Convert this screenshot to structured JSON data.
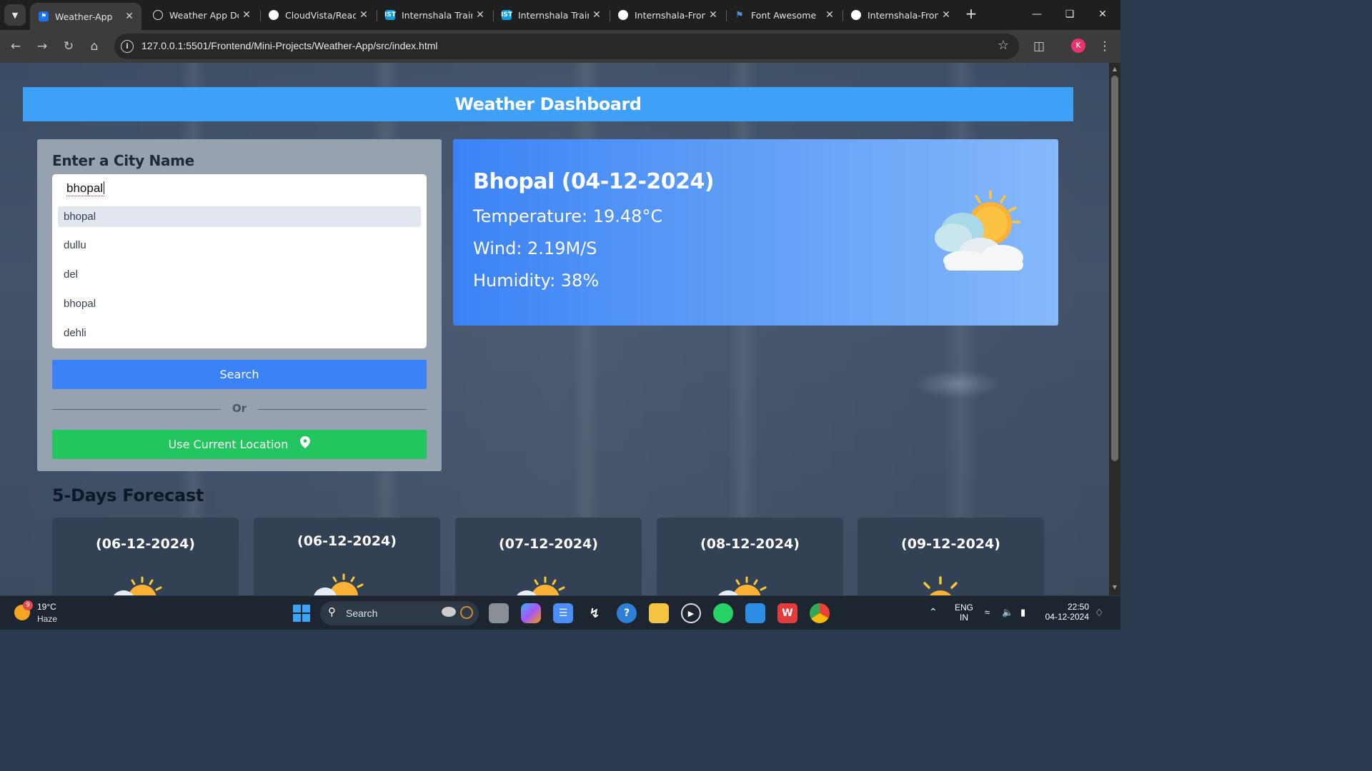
{
  "browser": {
    "tabs": [
      {
        "title": "Weather-App",
        "favicon": "weather-favicon",
        "active": true
      },
      {
        "title": "Weather App Do",
        "favicon": "chatgpt-favicon"
      },
      {
        "title": "CloudVista/Read",
        "favicon": "github-favicon"
      },
      {
        "title": "Internshala Train",
        "favicon": "ist-favicon"
      },
      {
        "title": "Internshala Train",
        "favicon": "ist-favicon"
      },
      {
        "title": "Internshala-Fron",
        "favicon": "github-favicon"
      },
      {
        "title": "Font Awesome",
        "favicon": "fontawesome-favicon"
      },
      {
        "title": "Internshala-Fron",
        "favicon": "github-favicon"
      }
    ],
    "favicon_text": {
      "ist": "IST"
    },
    "url": "127.0.0.1:5501/Frontend/Mini-Projects/Weather-App/src/index.html",
    "profile_initial": "K"
  },
  "app": {
    "title": "Weather Dashboard",
    "search": {
      "label": "Enter a City Name",
      "value": "bhopal",
      "suggestions": [
        "bhopal",
        "dullu",
        "del",
        "bhopal",
        "dehli"
      ],
      "search_button": "Search",
      "or_text": "Or",
      "location_button": "Use Current Location"
    },
    "current": {
      "heading": "Bhopal (04-12-2024)",
      "temperature": "Temperature: 19.48°C",
      "wind": "Wind: 2.19M/S",
      "humidity": "Humidity: 38%",
      "icon": "partly-cloudy-sun-icon"
    },
    "forecast": {
      "title": "5-Days Forecast",
      "days": [
        {
          "date": "(06-12-2024)",
          "icon": "partly-cloudy-sun-icon"
        },
        {
          "date": "(06-12-2024)",
          "icon": "partly-cloudy-sun-icon"
        },
        {
          "date": "(07-12-2024)",
          "icon": "partly-cloudy-sun-icon"
        },
        {
          "date": "(08-12-2024)",
          "icon": "partly-cloudy-sun-icon"
        },
        {
          "date": "(09-12-2024)",
          "icon": "sun-icon"
        }
      ]
    }
  },
  "taskbar": {
    "weather": {
      "badge": "9",
      "temp": "19°C",
      "condition": "Haze"
    },
    "search_label": "Search",
    "language": {
      "line1": "ENG",
      "line2": "IN"
    },
    "time": "22:50",
    "date": "04-12-2024"
  },
  "colors": {
    "header": "#3ea0f7",
    "search_button": "#3b82f6",
    "location_button": "#22c55e",
    "forecast_card": "#334155"
  }
}
